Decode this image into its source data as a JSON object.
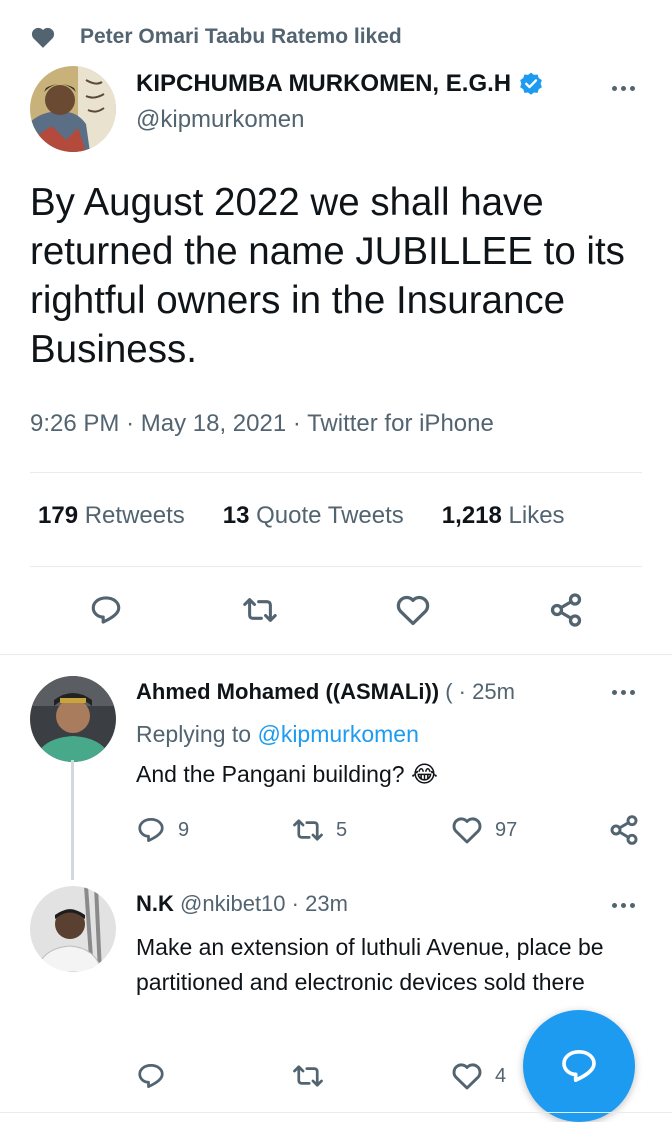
{
  "social_context": {
    "text": "Peter Omari Taabu Ratemo liked"
  },
  "tweet": {
    "author_name": "KIPCHUMBA MURKOMEN, E.G.H",
    "author_handle": "@kipmurkomen",
    "verified": true,
    "text": "By August 2022 we shall have returned the name JUBILLEE to its rightful owners in the Insurance Business.",
    "time": "9:26 PM",
    "date": "May 18, 2021",
    "source": "Twitter for iPhone",
    "stats": {
      "retweets_count": "179",
      "retweets_label": "Retweets",
      "quotes_count": "13",
      "quotes_label": "Quote Tweets",
      "likes_count": "1,218",
      "likes_label": "Likes"
    }
  },
  "replies": [
    {
      "name": "Ahmed Mohamed ((ASMALi))",
      "handle_fragment": "(",
      "time": "25m",
      "replying_prefix": "Replying to",
      "replying_to": "@kipmurkomen",
      "text": "And the Pangani building? 😂",
      "reply_count": "9",
      "retweet_count": "5",
      "like_count": "97"
    },
    {
      "name": "N.K",
      "handle": "@nkibet10",
      "time": "23m",
      "text": "Make an extension of luthuli Avenue, place be partitioned and electronic devices sold there",
      "like_count": "4"
    }
  ],
  "colors": {
    "accent": "#1d9bf0",
    "text": "#0f1419",
    "secondary": "#536471",
    "divider": "#e6ecf0"
  },
  "icons": [
    "heart-icon",
    "verified-badge-icon",
    "more-icon",
    "reply-icon",
    "retweet-icon",
    "like-icon",
    "share-icon",
    "compose-reply-icon"
  ]
}
